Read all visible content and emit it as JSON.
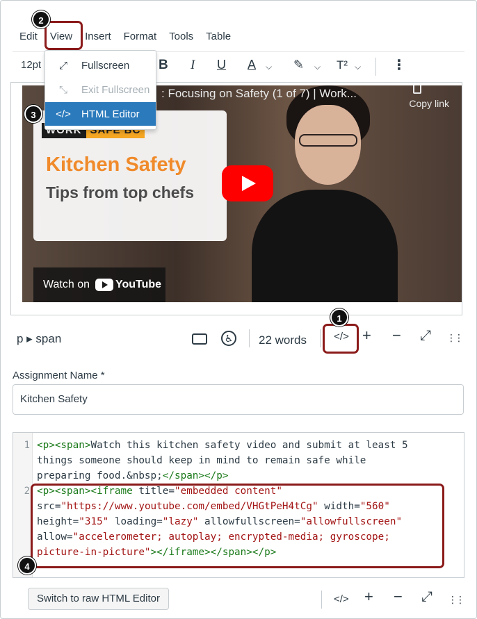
{
  "menubar": {
    "items": [
      "Edit",
      "View",
      "Insert",
      "Format",
      "Tools",
      "Table"
    ]
  },
  "toolbar": {
    "font_size": "12pt",
    "bold_label": "B",
    "italic_label": "I",
    "underline_label": "U",
    "text_color_label": "A",
    "superscript_label": "T²",
    "more_label": "⋮"
  },
  "view_menu": {
    "items": [
      {
        "label": "Fullscreen",
        "icon": "expand-icon",
        "glyph": "⤢",
        "state": "normal"
      },
      {
        "label": "Exit Fullscreen",
        "icon": "shrink-icon",
        "glyph": "⤡",
        "state": "disabled"
      },
      {
        "label": "HTML Editor",
        "icon": "code-icon",
        "glyph": "</>",
        "state": "active"
      }
    ]
  },
  "video": {
    "title": ": Focusing on Safety (1 of 7) | Work...",
    "copy_link": "Copy link",
    "brand_part1": "WORK",
    "brand_part2": "SAFE BC",
    "card_title": "Kitchen Safety",
    "card_subtitle": "Tips from top chefs",
    "watch_on": "Watch on",
    "youtube": "YouTube"
  },
  "statusbar": {
    "path": "p ▸ span",
    "word_count": "22 words",
    "code_label": "</>",
    "plus": "+",
    "minus": "−",
    "expand": "⤢",
    "drag": "⋮⋮"
  },
  "assignment": {
    "label": "Assignment Name *",
    "value": "Kitchen Safety"
  },
  "code_editor": {
    "line_numbers": [
      "1",
      "2"
    ]
  },
  "bottom": {
    "raw_button": "Switch to raw HTML Editor",
    "code_label": "</>",
    "plus": "+",
    "minus": "−",
    "expand": "⤢",
    "drag": "⋮⋮"
  },
  "annotations": [
    "1",
    "2",
    "3",
    "4"
  ],
  "colors": {
    "highlight": "#8b1a1a",
    "active_menu": "#2b7abc",
    "tag": "#1a7a1a",
    "string": "#a31515"
  }
}
